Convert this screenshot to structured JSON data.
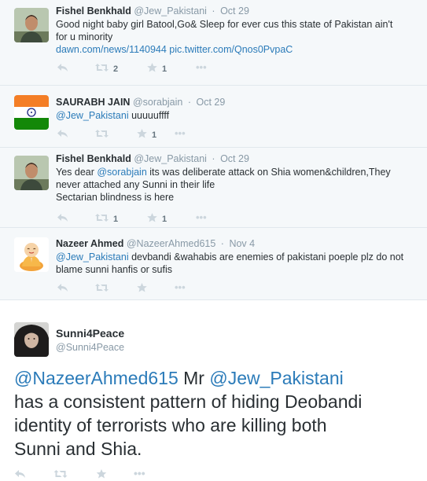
{
  "replies": [
    {
      "name": "Fishel Benkhald",
      "handle": "@Jew_Pakistani",
      "time": "Oct 29",
      "avatar": "man-portrait-avatar",
      "lines": [
        {
          "text": "Good night baby girl Batool,Go& Sleep for ever cus this state of Pakistan ain't"
        },
        {
          "text": "for u minority"
        },
        {
          "link": "dawn.com/news/1140944 pic.twitter.com/Qnos0PvpaC"
        }
      ],
      "retweets": "2",
      "favorites": "1"
    },
    {
      "name": "SAURABH JAIN",
      "handle": "@sorabjain",
      "time": "Oct 29",
      "avatar": "india-flag-avatar",
      "mention": "@Jew_Pakistani",
      "rest": " uuuuuffff",
      "retweets": "",
      "favorites": "1"
    },
    {
      "name": "Fishel Benkhald",
      "handle": "@Jew_Pakistani",
      "time": "Oct 29",
      "avatar": "man-portrait-avatar",
      "pre": "Yes dear ",
      "mention": "@sorabjain",
      "rest": " its was deliberate attack on Shia women&children,They",
      "line2": "never attached any Sunni in their life",
      "line3": "Sectarian blindness is here",
      "retweets": "1",
      "favorites": "1"
    },
    {
      "name": "Nazeer Ahmed",
      "handle": "@NazeerAhmed615",
      "time": "Nov 4",
      "avatar": "praying-monk-avatar",
      "mention": "@Jew_Pakistani",
      "rest": " devbandi &wahabis are enemies of pakistani poeple plz do not",
      "line2": "blame sunni hanfis or sufis",
      "retweets": "",
      "favorites": ""
    }
  ],
  "main": {
    "name": "Sunni4Peace",
    "handle": "@Sunni4Peace",
    "avatar": "woman-portrait-avatar",
    "mention1": "@NazeerAhmed615",
    "mid": " Mr ",
    "mention2": "@Jew_Pakistani",
    "line2": "has a consistent pattern of hiding Deobandi",
    "line3": "identity of terrorists who are killing both",
    "line4": "Sunni and Shia."
  },
  "colors": {
    "link": "#2b7bb9",
    "reply_bg": "#f5f8fa",
    "muted": "#8899a6"
  }
}
